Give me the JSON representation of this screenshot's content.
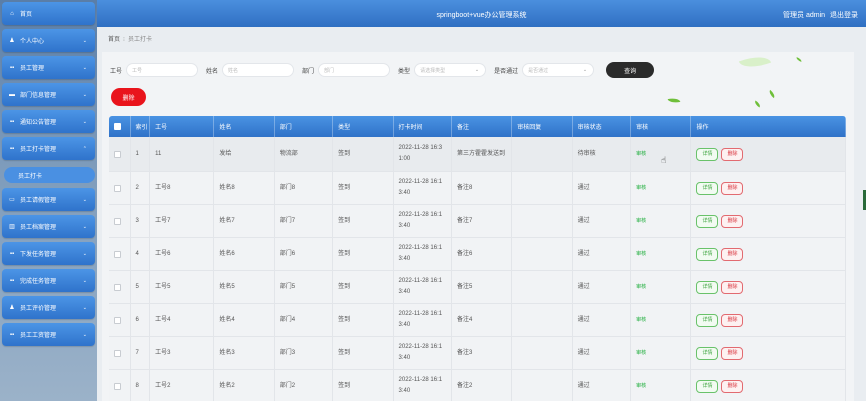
{
  "app_title": "springboot+vue办公管理系统",
  "user": {
    "prefix": "管理员 admin",
    "logout": "退出登录"
  },
  "sidebar": {
    "items": [
      {
        "label": "首页",
        "icon": "home-icon",
        "glyph": "⌂",
        "chevron": ""
      },
      {
        "label": "个人中心",
        "icon": "person-icon",
        "glyph": "♟",
        "chevron": "⌄"
      },
      {
        "label": "员工管理",
        "icon": "grid-icon",
        "glyph": "▪▪",
        "chevron": "⌄"
      },
      {
        "label": "部门信息管理",
        "icon": "chat-icon",
        "glyph": "▬",
        "chevron": "⌄"
      },
      {
        "label": "通知公告管理",
        "icon": "grid-icon",
        "glyph": "▪▪",
        "chevron": "⌄"
      },
      {
        "label": "员工打卡管理",
        "icon": "grid-icon",
        "glyph": "▪▪",
        "chevron": "⌃"
      },
      {
        "label": "员工请假管理",
        "icon": "card-icon",
        "glyph": "▭",
        "chevron": "⌄"
      },
      {
        "label": "员工档案管理",
        "icon": "chart-icon",
        "glyph": "▥",
        "chevron": "⌄"
      },
      {
        "label": "下发任务管理",
        "icon": "grid-icon",
        "glyph": "▪▪",
        "chevron": "⌄"
      },
      {
        "label": "完成任务管理",
        "icon": "grid-icon",
        "glyph": "▪▪",
        "chevron": "⌄"
      },
      {
        "label": "员工评价管理",
        "icon": "person-icon",
        "glyph": "♟",
        "chevron": "⌄"
      },
      {
        "label": "员工工资管理",
        "icon": "grid-icon",
        "glyph": "▪▪",
        "chevron": "⌄"
      }
    ],
    "sub_item": "员工打卡"
  },
  "breadcrumb": {
    "home": "首页",
    "current": "员工打卡"
  },
  "search": {
    "fields": [
      {
        "label": "工号",
        "placeholder": "工号"
      },
      {
        "label": "姓名",
        "placeholder": "姓名"
      },
      {
        "label": "部门",
        "placeholder": "部门"
      },
      {
        "label": "类型",
        "placeholder": "请选择类型"
      },
      {
        "label": "是否通过",
        "placeholder": "是否通过"
      }
    ],
    "query_label": "查询"
  },
  "delete_label": "删除",
  "table": {
    "headers": [
      "",
      "索引",
      "工号",
      "姓名",
      "部门",
      "类型",
      "打卡时间",
      "备注",
      "审核回复",
      "审核状态",
      "审核",
      "操作"
    ],
    "rows": [
      {
        "idx": "1",
        "no": "11",
        "name": "发给",
        "dept": "物流部",
        "type": "签到",
        "time1": "2022-11-28 16:3",
        "time2": "1:00",
        "note": "第三方霍霍发送到",
        "reply": "",
        "status": "待审核"
      },
      {
        "idx": "2",
        "no": "工号8",
        "name": "姓名8",
        "dept": "部门8",
        "type": "签到",
        "time1": "2022-11-28 16:1",
        "time2": "3:40",
        "note": "备注8",
        "reply": "",
        "status": "通过"
      },
      {
        "idx": "3",
        "no": "工号7",
        "name": "姓名7",
        "dept": "部门7",
        "type": "签到",
        "time1": "2022-11-28 16:1",
        "time2": "3:40",
        "note": "备注7",
        "reply": "",
        "status": "通过"
      },
      {
        "idx": "4",
        "no": "工号6",
        "name": "姓名6",
        "dept": "部门6",
        "type": "签到",
        "time1": "2022-11-28 16:1",
        "time2": "3:40",
        "note": "备注6",
        "reply": "",
        "status": "通过"
      },
      {
        "idx": "5",
        "no": "工号5",
        "name": "姓名5",
        "dept": "部门5",
        "type": "签到",
        "time1": "2022-11-28 16:1",
        "time2": "3:40",
        "note": "备注5",
        "reply": "",
        "status": "通过"
      },
      {
        "idx": "6",
        "no": "工号4",
        "name": "姓名4",
        "dept": "部门4",
        "type": "签到",
        "time1": "2022-11-28 16:1",
        "time2": "3:40",
        "note": "备注4",
        "reply": "",
        "status": "通过"
      },
      {
        "idx": "7",
        "no": "工号3",
        "name": "姓名3",
        "dept": "部门3",
        "type": "签到",
        "time1": "2022-11-28 16:1",
        "time2": "3:40",
        "note": "备注3",
        "reply": "",
        "status": "通过"
      },
      {
        "idx": "8",
        "no": "工号2",
        "name": "姓名2",
        "dept": "部门2",
        "type": "签到",
        "time1": "2022-11-28 16:1",
        "time2": "3:40",
        "note": "备注2",
        "reply": "",
        "status": "通过"
      }
    ],
    "audit_label": "审核",
    "detail_label": "详情",
    "row_delete_label": "删除"
  },
  "colors": {
    "header_blue": "#2f72c8",
    "delete_red": "#e9141c",
    "audit_green": "#1fae3c"
  }
}
